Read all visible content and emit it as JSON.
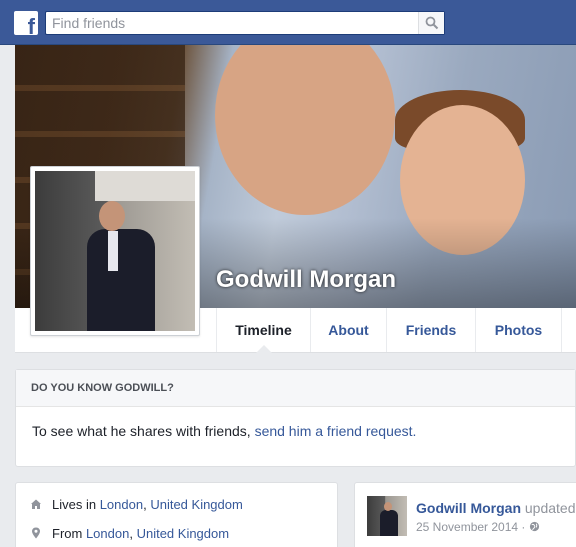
{
  "topbar": {
    "logo_letter": "f",
    "search_placeholder": "Find friends"
  },
  "profile": {
    "name": "Godwill Morgan"
  },
  "tabs": [
    {
      "label": "Timeline"
    },
    {
      "label": "About"
    },
    {
      "label": "Friends"
    },
    {
      "label": "Photos"
    }
  ],
  "know_box": {
    "header": "DO YOU KNOW GODWILL?",
    "text": "To see what he shares with friends, ",
    "link": "send him a friend request."
  },
  "intro": {
    "lives_label": "Lives in ",
    "lives_city": "London",
    "lives_sep": ", ",
    "lives_country": "United Kingdom",
    "from_label": "From ",
    "from_city": "London",
    "from_sep": ", ",
    "from_country": "United Kingdom"
  },
  "post": {
    "author": "Godwill Morgan",
    "action": " updated",
    "date": "25 November 2014 · "
  },
  "colors": {
    "topbar": "#3b5998",
    "link": "#365899",
    "page_bg": "#e9ebee"
  },
  "icons": [
    "facebook-logo-icon",
    "search-icon",
    "home-icon",
    "location-pin-icon",
    "globe-icon"
  ]
}
